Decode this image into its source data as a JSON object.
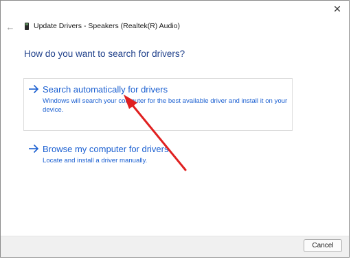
{
  "window": {
    "title": "Update Drivers - Speakers (Realtek(R) Audio)",
    "close_glyph": "✕",
    "back_glyph": "←"
  },
  "heading": "How do you want to search for drivers?",
  "options": [
    {
      "title": "Search automatically for drivers",
      "description": "Windows will search your computer for the best available driver and install it on your device."
    },
    {
      "title": "Browse my computer for drivers",
      "description": "Locate and install a driver manually."
    }
  ],
  "footer": {
    "cancel_label": "Cancel"
  },
  "colors": {
    "link_blue": "#1a5fd1",
    "heading_blue": "#1e3f8a",
    "annotation_red": "#e02020"
  },
  "icons": {
    "option_arrow": "right-arrow-icon",
    "device": "speaker-device-icon"
  }
}
